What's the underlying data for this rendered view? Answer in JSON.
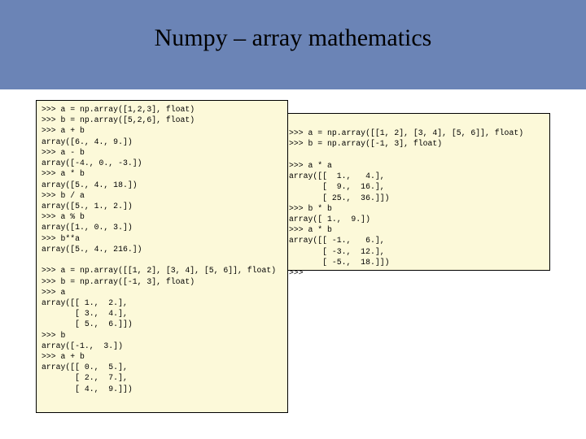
{
  "title": "Numpy – array mathematics",
  "left_code": ">>> a = np.array([1,2,3], float)\n>>> b = np.array([5,2,6], float)\n>>> a + b\narray([6., 4., 9.])\n>>> a - b\narray([-4., 0., -3.])\n>>> a * b\narray([5., 4., 18.])\n>>> b / a\narray([5., 1., 2.])\n>>> a % b\narray([1., 0., 3.])\n>>> b**a\narray([5., 4., 216.])\n\n>>> a = np.array([[1, 2], [3, 4], [5, 6]], float)\n>>> b = np.array([-1, 3], float)\n>>> a\narray([[ 1.,  2.],\n       [ 3.,  4.],\n       [ 5.,  6.]])\n>>> b\narray([-1.,  3.])\n>>> a + b\narray([[ 0.,  5.],\n       [ 2.,  7.],\n       [ 4.,  9.]])",
  "right_code": "\n>>> a = np.array([[1, 2], [3, 4], [5, 6]], float)\n>>> b = np.array([-1, 3], float)\n\n>>> a * a\narray([[  1.,   4.],\n       [  9.,  16.],\n       [ 25.,  36.]])\n>>> b * b\narray([ 1.,  9.])\n>>> a * b\narray([[ -1.,   6.],\n       [ -3.,  12.],\n       [ -5.,  18.]])\n>>>"
}
